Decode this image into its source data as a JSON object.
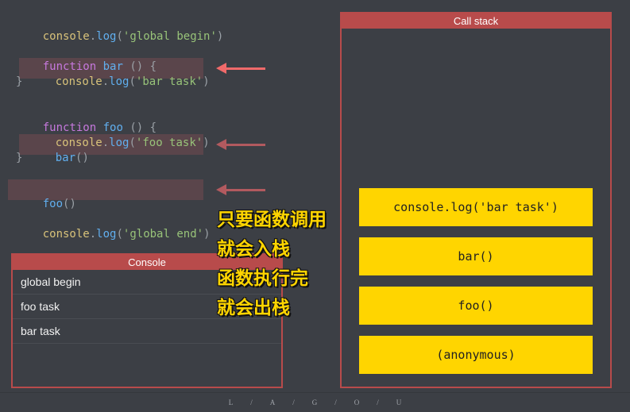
{
  "code": {
    "l1": {
      "obj": "console",
      "dot": ".",
      "fn": "log",
      "open": "(",
      "arg": "'global begin'",
      "close": ")"
    },
    "l2": {
      "kw": "function",
      "name": "bar",
      "sig": " () {"
    },
    "l3": {
      "obj": "console",
      "dot": ".",
      "fn": "log",
      "open": "(",
      "arg": "'bar task'",
      "close": ")"
    },
    "l4": "}",
    "l5": {
      "kw": "function",
      "name": "foo",
      "sig": " () {"
    },
    "l6": {
      "obj": "console",
      "dot": ".",
      "fn": "log",
      "open": "(",
      "arg": "'foo task'",
      "close": ")"
    },
    "l7": {
      "name": "bar",
      "call": "()"
    },
    "l8": "}",
    "l9": {
      "name": "foo",
      "call": "()"
    },
    "l10": {
      "obj": "console",
      "dot": ".",
      "fn": "log",
      "open": "(",
      "arg": "'global end'",
      "close": ")"
    }
  },
  "console_panel": {
    "title": "Console",
    "rows": [
      "global begin",
      "foo task",
      "bar task"
    ]
  },
  "call_stack_panel": {
    "title": "Call stack",
    "frames": [
      "console.log('bar task')",
      "bar()",
      "foo()",
      "(anonymous)"
    ]
  },
  "overlay": {
    "line1": "只要函数调用",
    "line2": "就会入栈",
    "line3": "函数执行完",
    "line4": "就会出栈"
  },
  "footer": [
    "L",
    "/",
    "A",
    "/",
    "G",
    "/",
    "O",
    "/",
    "U"
  ],
  "colors": {
    "background": "#3c3f45",
    "panel_border": "#b84b4b",
    "frame_fill": "#ffd500",
    "arrow_active": "#f06a6a",
    "arrow_inactive": "#b25a5f",
    "highlight": "#5a454b"
  }
}
